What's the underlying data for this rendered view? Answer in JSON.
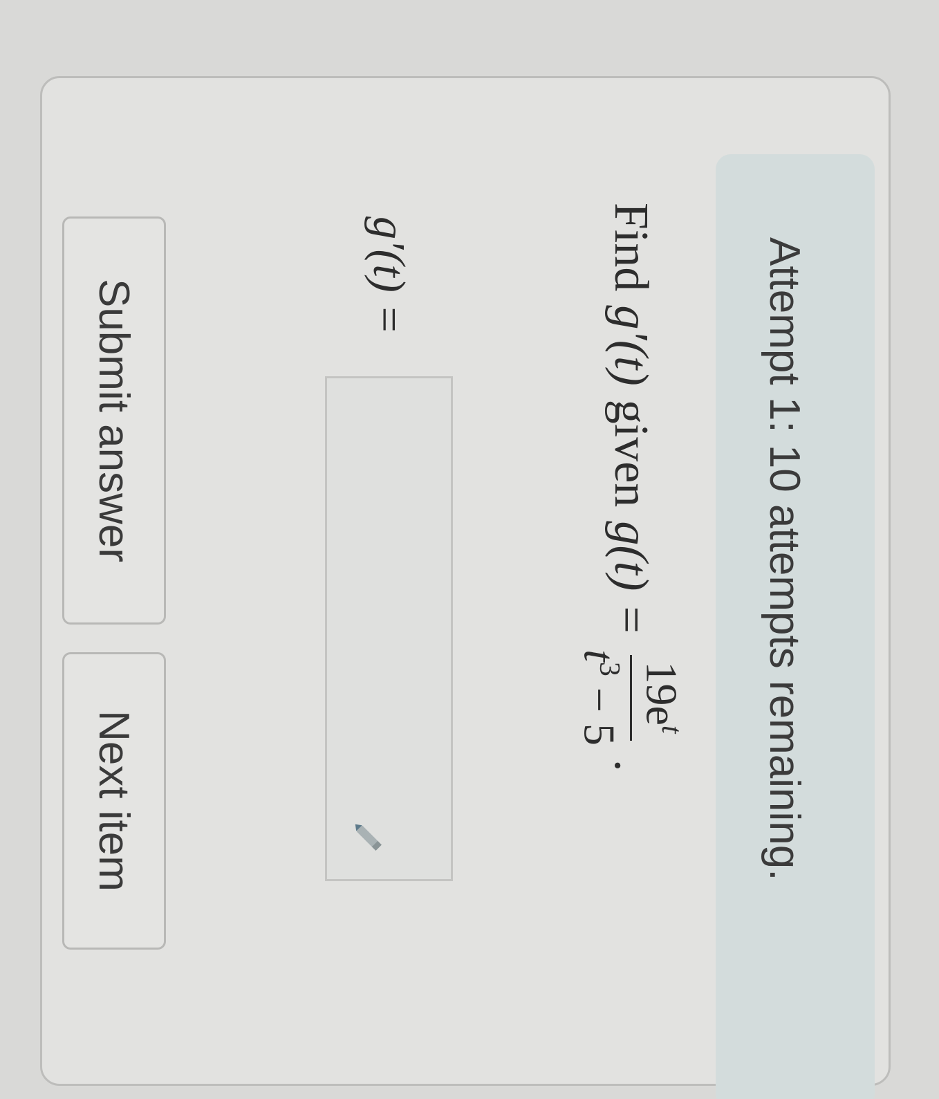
{
  "banner": {
    "text": "Attempt 1: 10 attempts remaining."
  },
  "question": {
    "find_word": "Find",
    "derivative": "g′(t)",
    "given_word": "given",
    "function": "g(t) =",
    "numerator_base": "19e",
    "numerator_exp": "t",
    "denominator_base": "t",
    "denominator_exp": "3",
    "denominator_rest": " − 5",
    "period": "."
  },
  "answer": {
    "label": "g′(t) =",
    "value": "",
    "placeholder": ""
  },
  "buttons": {
    "submit_label": "Submit answer",
    "next_label": "Next item"
  },
  "icons": {
    "edit": "pencil-icon"
  }
}
